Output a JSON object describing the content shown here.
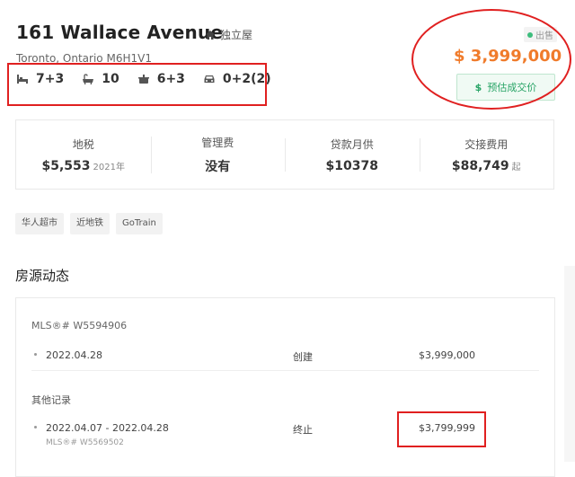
{
  "listing": {
    "title": "161 Wallace Avenue",
    "house_type": "独立屋",
    "address": "Toronto, Ontario M6H1V1",
    "specs": {
      "bedrooms": "7+3",
      "bathrooms": "10",
      "kitchens": "6+3",
      "parking": "0+2(2)"
    },
    "status": "出售",
    "price": "$ 3,999,000",
    "estimate_button": "预估成交价"
  },
  "fees": [
    {
      "label": "地税",
      "value": "$5,553",
      "suffix": "2021年"
    },
    {
      "label": "管理费",
      "value": "没有",
      "suffix": ""
    },
    {
      "label": "贷款月供",
      "value": "$10378",
      "suffix": ""
    },
    {
      "label": "交接费用",
      "value": "$88,749",
      "suffix": "起"
    }
  ],
  "tags": [
    "华人超市",
    "近地铁",
    "GoTrain"
  ],
  "history": {
    "section_title": "房源动态",
    "mls_label": "MLS®# W5594906",
    "current": {
      "date": "2022.04.28",
      "event": "创建",
      "price": "$3,999,000"
    },
    "other_title": "其他记录",
    "other": [
      {
        "date": "2022.04.07 - 2022.04.28",
        "mls": "MLS®# W5569502",
        "event": "终止",
        "price": "$3,799,999"
      }
    ]
  },
  "colors": {
    "accent_orange": "#f07b2b",
    "accent_green": "#28a466",
    "annotation_red": "#e02020"
  },
  "icons": [
    "house-icon",
    "bed-icon",
    "bathtub-icon",
    "kitchen-icon",
    "car-icon",
    "dollar-icon"
  ]
}
